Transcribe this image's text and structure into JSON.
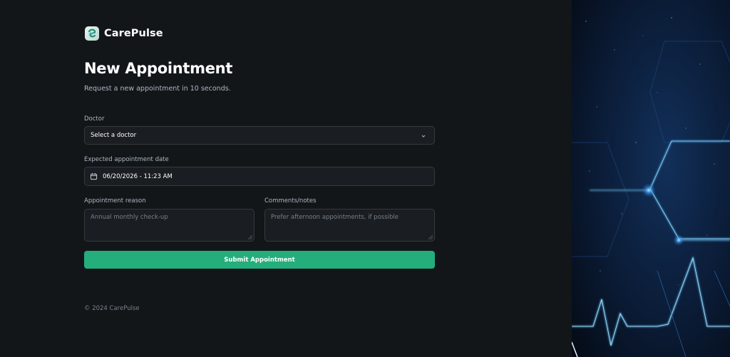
{
  "brand": {
    "name": "CarePulse",
    "icon": "carepulse-logo-icon"
  },
  "header": {
    "title": "New Appointment",
    "subtitle": "Request a new appointment in 10 seconds."
  },
  "form": {
    "doctor": {
      "label": "Doctor",
      "value": "Select a doctor",
      "icon": "chevron-down-icon"
    },
    "date": {
      "label": "Expected appointment date",
      "value": "06/20/2026 - 11:23 AM",
      "icon": "calendar-icon"
    },
    "reason": {
      "label": "Appointment reason",
      "placeholder": "Annual monthly check-up"
    },
    "notes": {
      "label": "Comments/notes",
      "placeholder": "Prefer afternoon appointments, if possible"
    },
    "submit_label": "Submit Appointment"
  },
  "footer": {
    "copyright": "© 2024 CarePulse"
  },
  "colors": {
    "background": "#131619",
    "input_background": "#1a1d21",
    "input_border": "#363a3d",
    "accent": "#24ae7c",
    "muted_text": "#abb8c4",
    "placeholder_text": "#76828d"
  }
}
